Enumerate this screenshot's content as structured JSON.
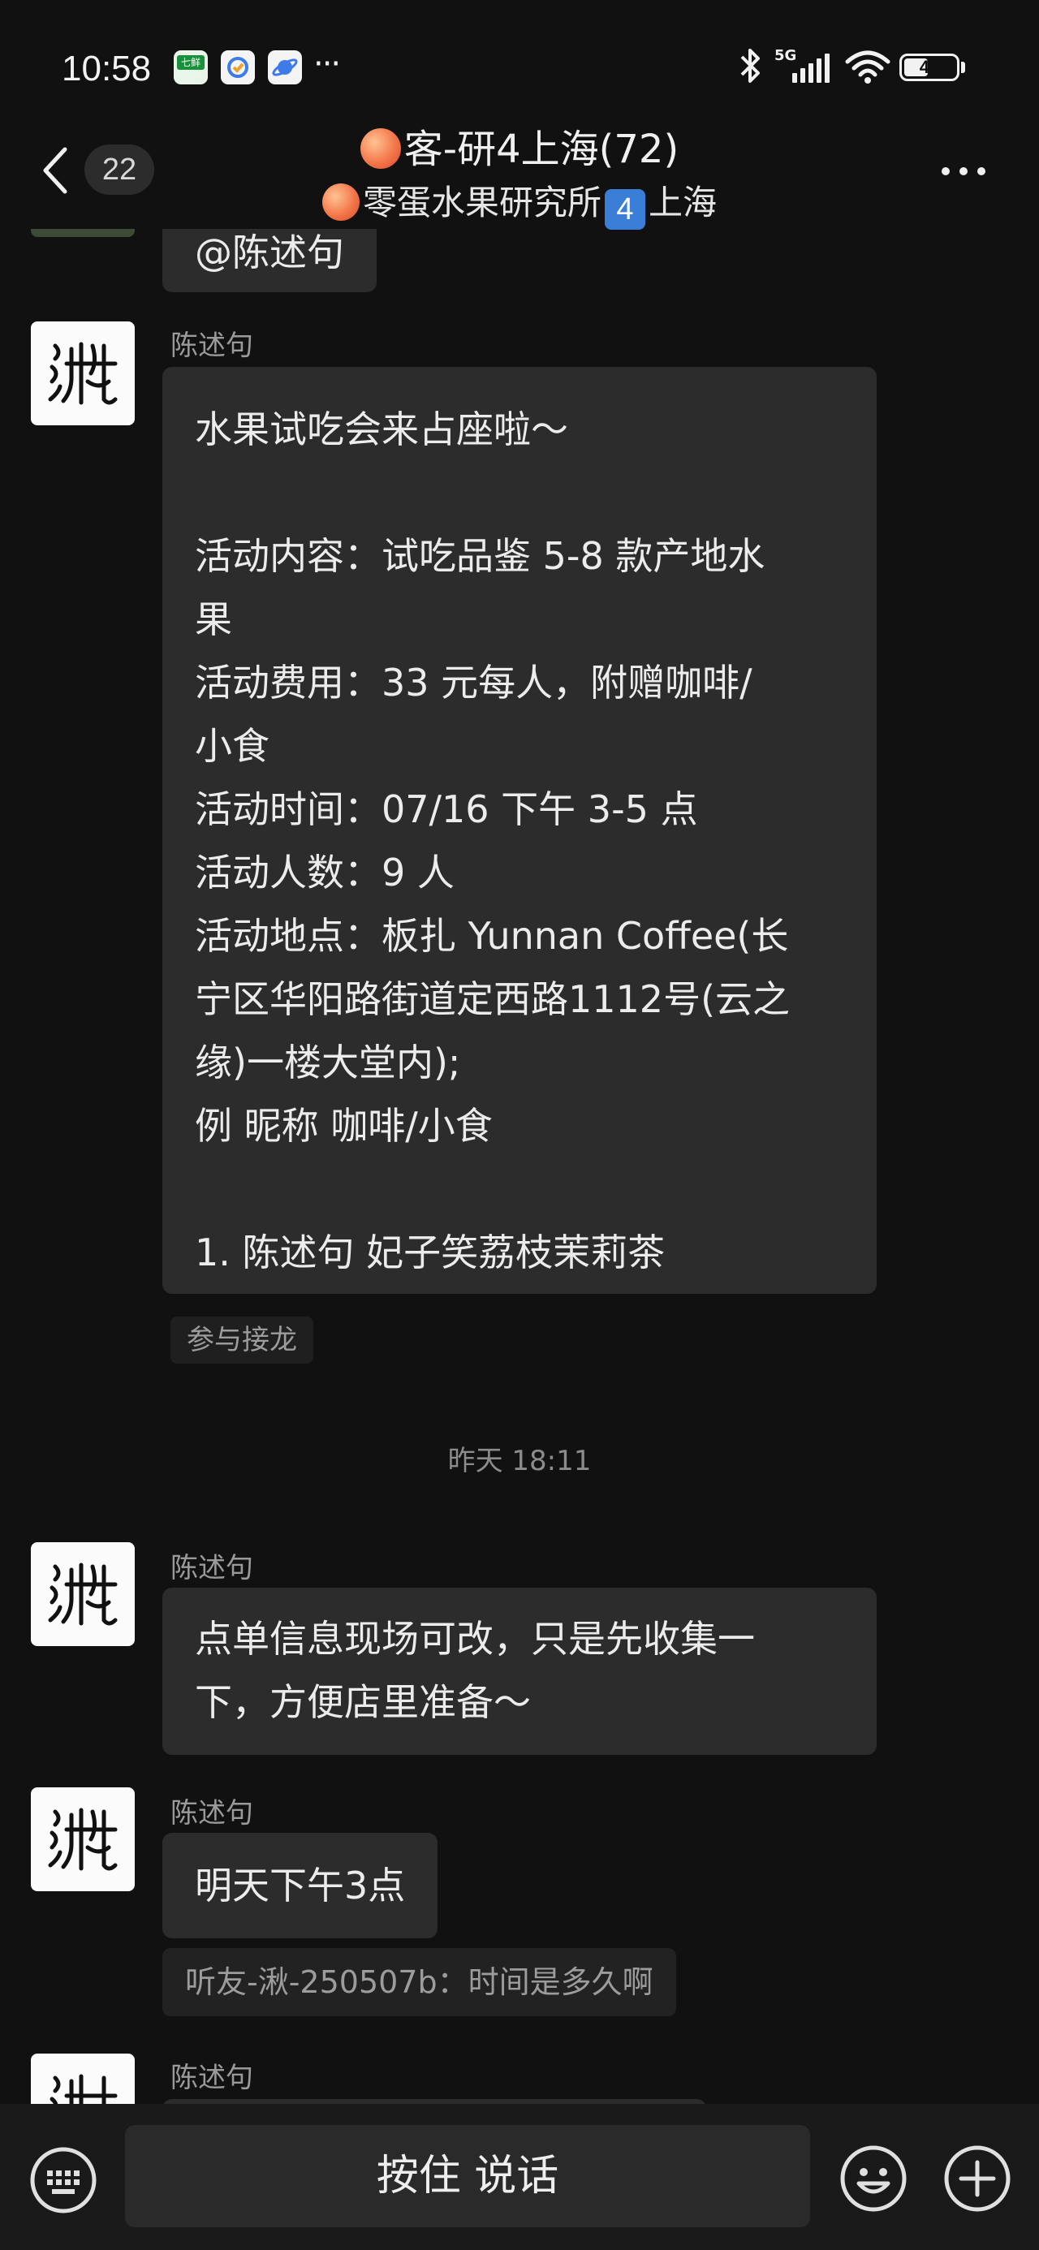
{
  "status_bar": {
    "time": "10:58",
    "network": "5G",
    "battery": "47",
    "battery_level_percent": 47,
    "more": "···",
    "app_icons": [
      "七鲜",
      "clock-check",
      "planet"
    ]
  },
  "header": {
    "unread_count": "22",
    "title": "客-研4上海(72)",
    "subtitle_part1": "零蛋水果研究所",
    "subtitle_key": "4",
    "subtitle_part2": "上海"
  },
  "messages": {
    "partial": {
      "text": "@陈述句"
    },
    "m1": {
      "sender": "陈述句",
      "lines": [
        "水果试吃会来占座啦～",
        "",
        "活动内容：试吃品鉴 5-8 款产地水",
        "果",
        "活动费用：33 元每人，附赠咖啡/",
        "小食",
        "活动时间：07/16 下午 3-5 点",
        "活动人数：9 人",
        "活动地点：板扎 Yunnan Coffee(长",
        "宁区华阳路街道定西路1112号(云之",
        "缘)一楼大堂内);",
        "例 昵称 咖啡/小食",
        "",
        "1. 陈述句 妃子笑荔枝茉莉茶"
      ],
      "action": "参与接龙"
    },
    "timestamp": "昨天 18:11",
    "m2": {
      "sender": "陈述句",
      "lines": [
        "点单信息现场可改，只是先收集一",
        "下，方便店里准备～"
      ]
    },
    "m3": {
      "sender": "陈述句",
      "text": "明天下午3点",
      "quote": "听友-湫-250507b：时间是多久啊"
    },
    "m4": {
      "sender": "陈述句"
    }
  },
  "input": {
    "talk_label": "按住 说话"
  },
  "colors": {
    "background": "#111111",
    "bubble": "#2c2c2c",
    "bottom_bar": "#1a1a1a",
    "secondary_text": "#9a9a9a"
  }
}
